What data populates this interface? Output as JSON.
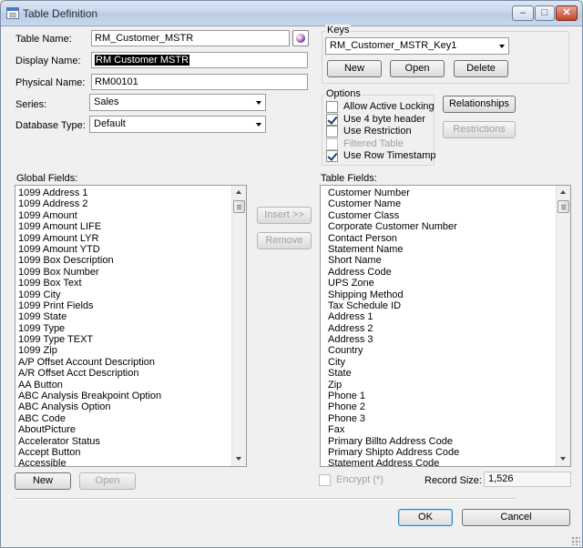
{
  "window": {
    "title": "Table Definition",
    "minimize": "–",
    "maximize": "□",
    "close": "✕"
  },
  "form": {
    "table_name_label": "Table Name:",
    "table_name": "RM_Customer_MSTR",
    "display_name_label": "Display Name:",
    "display_name": "RM Customer MSTR",
    "physical_name_label": "Physical Name:",
    "physical_name": "RM00101",
    "series_label": "Series:",
    "series": "Sales",
    "database_type_label": "Database Type:",
    "database_type": "Default"
  },
  "keys": {
    "title": "Keys",
    "selected": "RM_Customer_MSTR_Key1",
    "new_label": "New",
    "open_label": "Open",
    "delete_label": "Delete"
  },
  "options": {
    "title": "Options",
    "items": [
      {
        "label": "Allow Active Locking",
        "checked": false,
        "enabled": true
      },
      {
        "label": "Use 4 byte header",
        "checked": true,
        "enabled": true
      },
      {
        "label": "Use Restriction",
        "checked": false,
        "enabled": true
      },
      {
        "label": "Filtered Table",
        "checked": false,
        "enabled": false
      },
      {
        "label": "Use Row Timestamp",
        "checked": true,
        "enabled": true
      }
    ],
    "relationships_label": "Relationships",
    "restrictions_label": "Restrictions"
  },
  "global_fields": {
    "label": "Global Fields:",
    "items": [
      "1099 Address 1",
      "1099 Address 2",
      "1099 Amount",
      "1099 Amount LIFE",
      "1099 Amount LYR",
      "1099 Amount YTD",
      "1099 Box Description",
      "1099 Box Number",
      "1099 Box Text",
      "1099 City",
      "1099 Print Fields",
      "1099 State",
      "1099 Type",
      "1099 Type TEXT",
      "1099 Zip",
      "A/P Offset Account Description",
      "A/R Offset Acct Description",
      "AA Button",
      "ABC Analysis Breakpoint Option",
      "ABC Analysis Option",
      "ABC Code",
      "AboutPicture",
      "Accelerator Status",
      "Accept Button",
      "Accessible"
    ],
    "new_label": "New",
    "open_label": "Open"
  },
  "middle": {
    "insert_label": "Insert >>",
    "remove_label": "Remove"
  },
  "table_fields": {
    "label": "Table Fields:",
    "items": [
      "Customer Number",
      "Customer Name",
      "Customer Class",
      "Corporate Customer Number",
      "Contact Person",
      "Statement Name",
      "Short Name",
      "Address Code",
      "UPS Zone",
      "Shipping Method",
      "Tax Schedule ID",
      "Address 1",
      "Address 2",
      "Address 3",
      "Country",
      "City",
      "State",
      "Zip",
      "Phone 1",
      "Phone 2",
      "Phone 3",
      "Fax",
      "Primary Billto Address Code",
      "Primary Shipto Address Code",
      "Statement Address Code"
    ]
  },
  "footer": {
    "encrypt_label": "Encrypt (*)",
    "encrypt_checked": false,
    "record_size_label": "Record Size:",
    "record_size": "1,526",
    "ok_label": "OK",
    "cancel_label": "Cancel"
  }
}
